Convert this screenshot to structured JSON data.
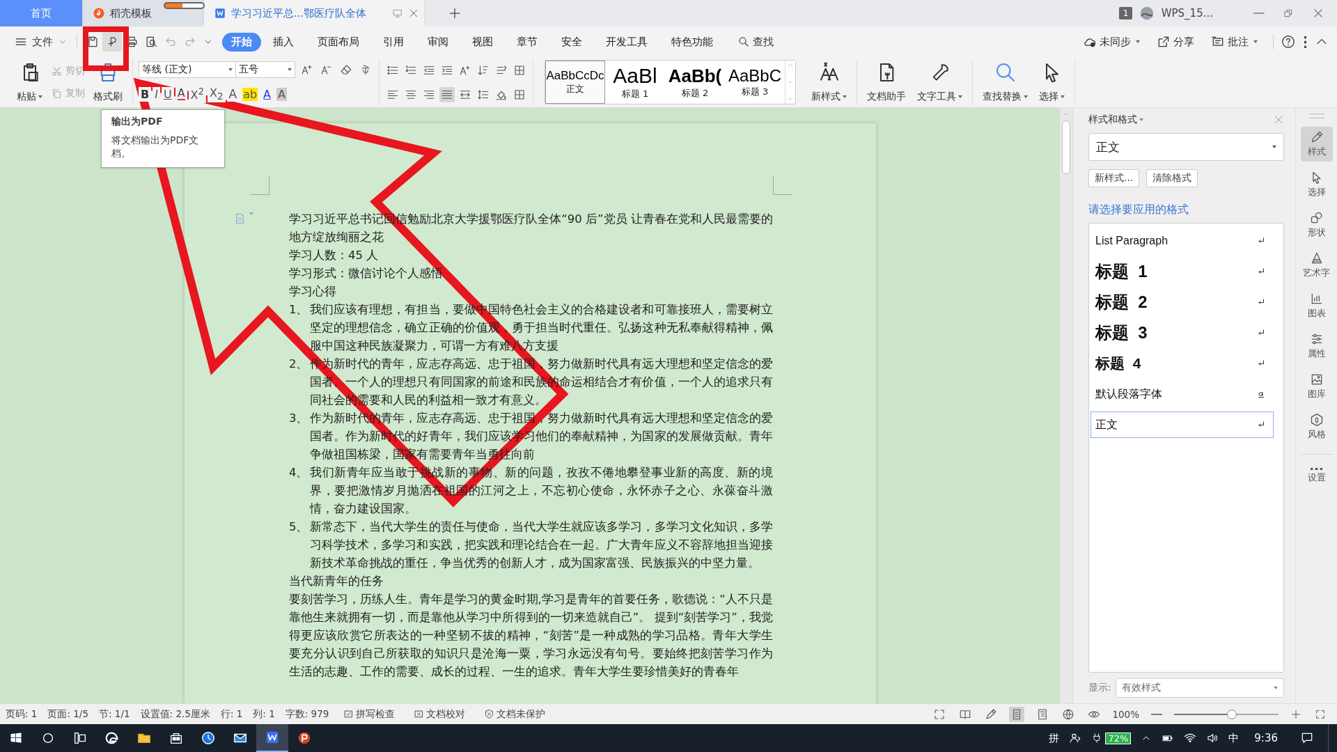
{
  "tabs": [
    {
      "label": "首页",
      "kind": "home",
      "selected": false
    },
    {
      "label": "稻壳模板",
      "kind": "template",
      "selected": false
    },
    {
      "label": "学习习近平总...鄂医疗队全体",
      "kind": "document",
      "selected": true
    }
  ],
  "title_bar": {
    "window_count": "1",
    "account_name": "WPS_15..."
  },
  "menu_bar": {
    "file_menu": "文件",
    "quick_tools": [
      {
        "hovered": false,
        "disabled": false
      },
      {
        "hovered": true,
        "disabled": false
      },
      {
        "hovered": false,
        "disabled": false
      },
      {
        "hovered": false,
        "disabled": false
      },
      {
        "hovered": false,
        "disabled": true
      },
      {
        "hovered": false,
        "disabled": true
      }
    ],
    "ribbon_tabs": [
      {
        "label": "开始",
        "selected": true
      },
      {
        "label": "插入",
        "selected": false
      },
      {
        "label": "页面布局",
        "selected": false
      },
      {
        "label": "引用",
        "selected": false
      },
      {
        "label": "审阅",
        "selected": false
      },
      {
        "label": "视图",
        "selected": false
      },
      {
        "label": "章节",
        "selected": false
      },
      {
        "label": "安全",
        "selected": false
      },
      {
        "label": "开发工具",
        "selected": false
      },
      {
        "label": "特色功能",
        "selected": false
      }
    ],
    "search": "查找",
    "sync": "未同步",
    "share": "分享",
    "comment": "批注"
  },
  "ribbon": {
    "paste": "粘贴",
    "cut": {
      "label": "剪切",
      "disabled": true
    },
    "copy": {
      "label": "复制",
      "disabled": true
    },
    "format_painter": "格式刷",
    "font_name": "等线 (正文)",
    "font_size": "五号",
    "font_effects": [
      "B",
      "I",
      "U",
      "A",
      "X$^{2}$",
      "X$_{2}$",
      "A",
      "ab",
      "A",
      "A"
    ],
    "alignment": [
      {
        "selected": false
      },
      {
        "selected": false
      },
      {
        "selected": false
      },
      {
        "selected": true
      }
    ],
    "style_gallery": [
      {
        "preview": "AaBbCcDc",
        "label": "正文",
        "selected": true
      },
      {
        "preview": "AaBl",
        "label": "标题 1",
        "selected": false
      },
      {
        "preview": "AaBb(",
        "label": "标题 2",
        "selected": false
      },
      {
        "preview": "AaBbC",
        "label": "标题 3",
        "selected": false
      }
    ],
    "new_style": "新样式",
    "doc_assistant": "文档助手",
    "text_tools": "文字工具",
    "find_replace": "查找替换",
    "select": "选择"
  },
  "tooltip": {
    "title": "输出为PDF",
    "text": "将文档输出为PDF文档。"
  },
  "document": {
    "paragraphs": [
      {
        "kind": "plain",
        "text": "学习习近平总书记回信勉励北京大学援鄂医疗队全体“90 后”党员  让青春在党和人民最需要的地方绽放绚丽之花"
      },
      {
        "kind": "plain",
        "text": "学习人数：45 人"
      },
      {
        "kind": "plain",
        "text": "学习形式：微信讨论个人感悟"
      },
      {
        "kind": "plain",
        "text": "学习心得"
      },
      {
        "kind": "numbered",
        "number": "1、",
        "text": "我们应该有理想，有担当，要做中国特色社会主义的合格建设者和可靠接班人，需要树立坚定的理想信念，确立正确的价值观，勇于担当时代重任。弘扬这种无私奉献得精神，佩服中国这种民族凝聚力，可谓一方有难八方支援"
      },
      {
        "kind": "numbered",
        "number": "2、",
        "text": "作为新时代的青年，应志存高远、忠于祖国，努力做新时代具有远大理想和坚定信念的爱国者。一个人的理想只有同国家的前途和民族的命运相结合才有价值，一个人的追求只有同社会的需要和人民的利益相一致才有意义。"
      },
      {
        "kind": "numbered",
        "number": "3、",
        "text": "作为新时代的青年，应志存高远、忠于祖国，努力做新时代具有远大理想和坚定信念的爱国者。作为新时代的好青年，我们应该学习他们的奉献精神，为国家的发展做贡献。青年争做祖国栋梁，国家有需要青年当勇往向前"
      },
      {
        "kind": "numbered",
        "number": "4、",
        "text": "我们新青年应当敢于挑战新的事物、新的问题，孜孜不倦地攀登事业新的高度、新的境界，要把激情岁月抛洒在祖国的江河之上，不忘初心使命，永怀赤子之心、永葆奋斗激情，奋力建设国家。"
      },
      {
        "kind": "numbered",
        "number": "5、",
        "text": "新常态下，当代大学生的责任与使命，当代大学生就应该多学习，多学习文化知识，多学习科学技术，多学习和实践，把实践和理论结合在一起。广大青年应义不容辞地担当迎接新技术革命挑战的重任，争当优秀的创新人才，成为国家富强、民族振兴的中坚力量。"
      },
      {
        "kind": "plain",
        "text": "当代新青年的任务"
      },
      {
        "kind": "plain",
        "text": "要刻苦学习，历练人生。青年是学习的黄金时期,学习是青年的首要任务，歌德说：“人不只是靠他生来就拥有一切，而是靠他从学习中所得到的一切来造就自己”。 提到“刻苦学习”，我觉得更应该欣赏它所表达的一种坚韧不拔的精神，“刻苦”是一种成熟的学习品格。青年大学生要充分认识到自己所获取的知识只是沧海一粟，学习永远没有句号。要始终把刻苦学习作为生活的志趣、工作的需要、成长的过程、一生的追求。青年大学生要珍惜美好的青春年"
      }
    ]
  },
  "styles_panel": {
    "title": "样式和格式",
    "current_style": "正文",
    "buttons": [
      "新样式...",
      "清除格式"
    ],
    "prompt": "请选择要应用的格式",
    "styles": [
      {
        "label": "List Paragraph",
        "kind": "paragraph",
        "selected": false
      },
      {
        "label": "标题  1",
        "kind": "heading1",
        "selected": false
      },
      {
        "label": "标题  2",
        "kind": "heading2",
        "selected": false
      },
      {
        "label": "标题  3",
        "kind": "heading3",
        "selected": false
      },
      {
        "label": "标题  4",
        "kind": "heading4",
        "selected": false
      },
      {
        "label": "默认段落字体",
        "kind": "character",
        "selected": false
      },
      {
        "label": "正文",
        "kind": "paragraph",
        "selected": true
      }
    ],
    "show_label": "显示:",
    "show_value": "有效样式"
  },
  "side_tools": [
    {
      "label": "样式",
      "selected": true
    },
    {
      "label": "选择",
      "selected": false
    },
    {
      "label": "形状",
      "selected": false
    },
    {
      "label": "艺术字",
      "selected": false
    },
    {
      "label": "图表",
      "selected": false
    },
    {
      "label": "属性",
      "selected": false
    },
    {
      "label": "图库",
      "selected": false
    },
    {
      "label": "风格",
      "selected": false
    },
    {
      "label": "设置",
      "selected": false
    }
  ],
  "status_bar": {
    "items": [
      "页码: 1",
      "页面: 1/5",
      "节: 1/1",
      "设置值: 2.5厘米",
      "行: 1",
      "列: 1",
      "字数: 979"
    ],
    "tools": [
      "拼写检查",
      "文档校对",
      "文档未保护"
    ],
    "view_modes": [
      {
        "selected": false
      },
      {
        "selected": false
      },
      {
        "selected": false
      },
      {
        "selected": true
      },
      {
        "selected": false
      },
      {
        "selected": false
      },
      {
        "selected": false
      }
    ],
    "zoom": "100%",
    "zoom_slider": {
      "level": 0.55
    }
  },
  "taskbar": {
    "apps": [
      {
        "selected": false
      },
      {
        "selected": false
      },
      {
        "selected": false
      },
      {
        "selected": false
      },
      {
        "selected": false
      },
      {
        "selected": false
      },
      {
        "selected": false
      },
      {
        "selected": true
      },
      {
        "selected": false
      }
    ],
    "ime": "拼",
    "battery": "72%",
    "input_language": "中",
    "time": "9:36"
  }
}
